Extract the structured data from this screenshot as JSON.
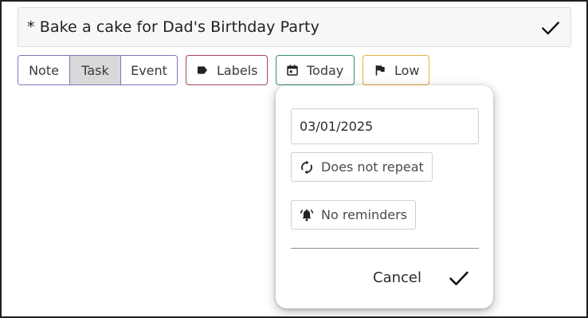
{
  "task": {
    "title": "* Bake a cake for Dad's Birthday Party"
  },
  "type_selector": {
    "options": [
      "Note",
      "Task",
      "Event"
    ],
    "selected": "Task"
  },
  "chips": {
    "labels": {
      "label": "Labels",
      "icon": "label-icon",
      "color": "#a0495a"
    },
    "date": {
      "label": "Today",
      "icon": "calendar-icon",
      "color": "#3e8a78"
    },
    "priority": {
      "label": "Low",
      "icon": "flag-icon",
      "color": "#e3b23c"
    }
  },
  "date_popup": {
    "date_value": "03/01/2025",
    "repeat_label": "Does not repeat",
    "reminder_label": "No reminders",
    "cancel_label": "Cancel"
  },
  "colors": {
    "segment_border": "#8a72b8",
    "segment_active_bg": "#d9d9d9"
  }
}
